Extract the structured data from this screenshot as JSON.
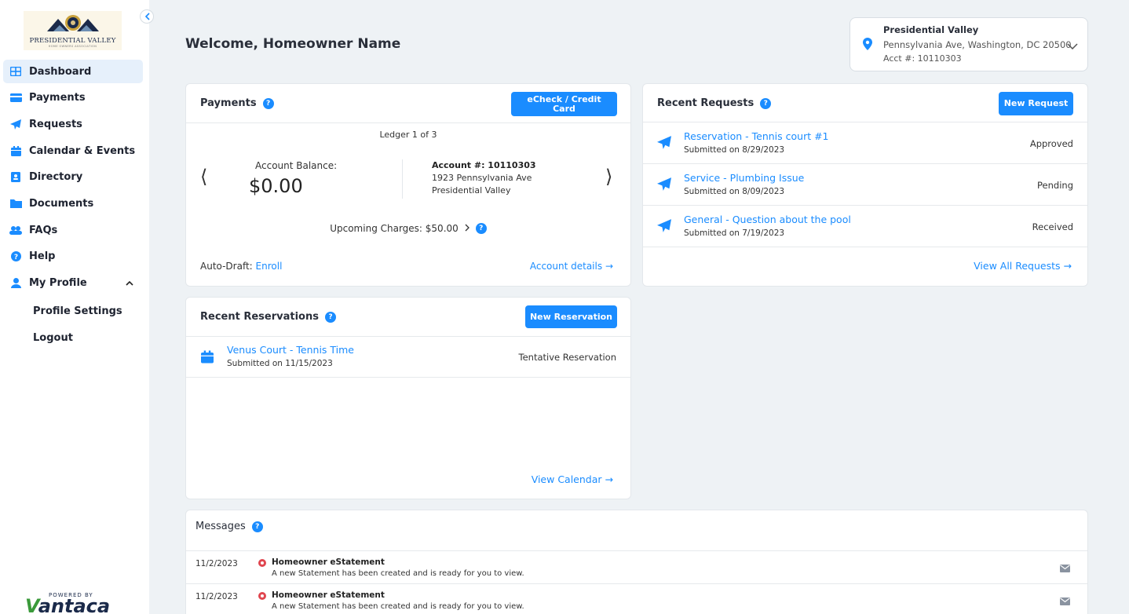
{
  "logo": {
    "name": "PRESIDENTIAL VALLEY",
    "subtitle": "HOME OWNERS ASSOCIATION"
  },
  "sidebar": {
    "items": [
      {
        "label": "Dashboard",
        "icon": "grid-icon"
      },
      {
        "label": "Payments",
        "icon": "credit-card-icon"
      },
      {
        "label": "Requests",
        "icon": "paper-plane-icon"
      },
      {
        "label": "Calendar & Events",
        "icon": "calendar-icon"
      },
      {
        "label": "Directory",
        "icon": "directory-icon"
      },
      {
        "label": "Documents",
        "icon": "folder-icon"
      },
      {
        "label": "FAQs",
        "icon": "people-icon"
      },
      {
        "label": "Help",
        "icon": "help-icon"
      },
      {
        "label": "My Profile",
        "icon": "user-icon"
      }
    ],
    "sub_items": [
      "Profile Settings",
      "Logout"
    ],
    "active": "Dashboard"
  },
  "powered": {
    "small": "POWERED BY",
    "v": "V",
    "rest": "antaca"
  },
  "header": {
    "welcome": "Welcome, Homeowner Name"
  },
  "account": {
    "name": "Presidential Valley",
    "address": "Pennsylvania Ave, Washington, DC 20500",
    "acct": "Acct #: 10110303"
  },
  "payments": {
    "title": "Payments",
    "button": "eCheck / Credit Card",
    "ledger": "Ledger 1 of 3",
    "balance_label": "Account Balance:",
    "balance": "$0.00",
    "account_no": "Account #: 10110303",
    "street": "1923 Pennsylvania Ave",
    "city": "Presidential Valley",
    "upcoming": "Upcoming Charges: $50.00",
    "autodraft_label": "Auto-Draft:",
    "autodraft_link": "Enroll",
    "details_link": "Account details"
  },
  "requests": {
    "title": "Recent Requests",
    "button": "New Request",
    "rows": [
      {
        "title": "Reservation - Tennis court #1",
        "sub": "Submitted on 8/29/2023",
        "status": "Approved"
      },
      {
        "title": "Service - Plumbing Issue",
        "sub": "Submitted on 8/09/2023",
        "status": "Pending"
      },
      {
        "title": "General - Question about the pool",
        "sub": "Submitted on 7/19/2023",
        "status": "Received"
      }
    ],
    "view_all": "View All Requests"
  },
  "reservations": {
    "title": "Recent Reservations",
    "button": "New Reservation",
    "row": {
      "title": "Venus Court - Tennis Time",
      "sub": "Submitted on 11/15/2023",
      "status": "Tentative Reservation"
    },
    "view_calendar": "View Calendar"
  },
  "messages": {
    "title": "Messages",
    "rows": [
      {
        "date": "11/2/2023",
        "title": "Homeowner eStatement",
        "body": "A new Statement has been created and is ready for you to view."
      },
      {
        "date": "11/2/2023",
        "title": "Homeowner eStatement",
        "body": "A new Statement has been created and is ready for you to view."
      }
    ]
  },
  "colors": {
    "accent": "#1a8cff",
    "sidebar_active": "#e6f0fb",
    "alert": "#e0464f",
    "background": "#eef2f5"
  }
}
